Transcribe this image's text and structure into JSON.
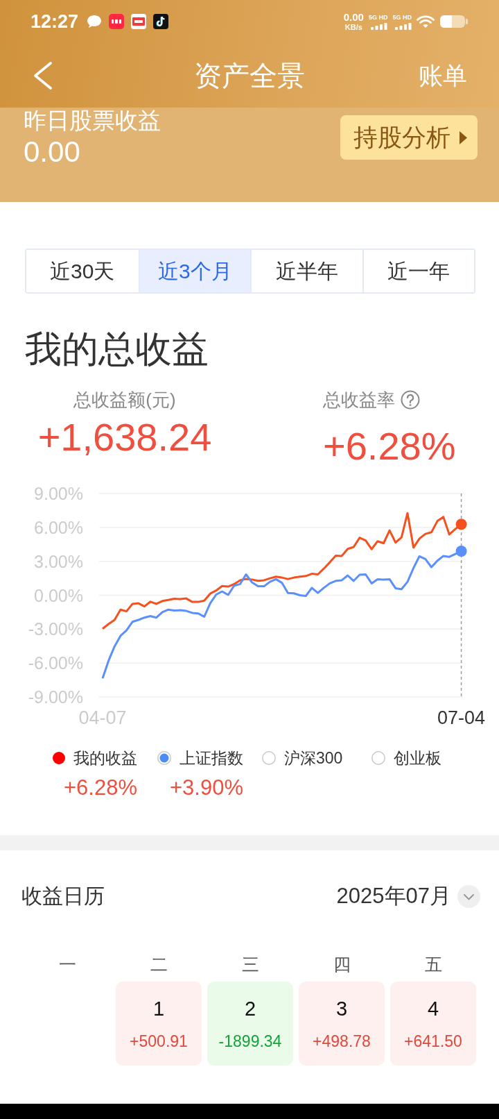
{
  "status_bar": {
    "time": "12:27",
    "net_speed": "0.00",
    "net_unit": "KB/s",
    "signals": [
      {
        "label": "5G HD"
      },
      {
        "label": "5G HD"
      }
    ]
  },
  "header": {
    "title": "资产全景",
    "action": "账单"
  },
  "summary": {
    "label": "昨日股票收益",
    "value": "0.00",
    "button": "持股分析"
  },
  "ranges": [
    {
      "label": "近30天",
      "selected": false
    },
    {
      "label": "近3个月",
      "selected": true
    },
    {
      "label": "近半年",
      "selected": false
    },
    {
      "label": "近一年",
      "selected": false
    }
  ],
  "earnings": {
    "title": "我的总收益",
    "metrics": [
      {
        "label": "总收益额(元)",
        "value": "+1,638.24"
      },
      {
        "label": "总收益率",
        "value": "+6.28%",
        "help": true
      }
    ],
    "chart_data": {
      "type": "line",
      "categories": [
        "04-07",
        null,
        null,
        null,
        null,
        null,
        null,
        null,
        null,
        null,
        null,
        null,
        null,
        null,
        null,
        null,
        null,
        null,
        null,
        null,
        null,
        null,
        null,
        null,
        null,
        null,
        null,
        null,
        null,
        null,
        null,
        null,
        null,
        null,
        null,
        null,
        null,
        null,
        null,
        null,
        null,
        null,
        null,
        null,
        null,
        null,
        null,
        null,
        null,
        null,
        null,
        null,
        null,
        null,
        null,
        null,
        null,
        null,
        null,
        null,
        "07-04"
      ],
      "series": [
        {
          "color": "#f4511e",
          "values": [
            -2.97,
            -2.55,
            -2.18,
            -1.27,
            -1.42,
            -0.76,
            -0.71,
            -0.99,
            -0.57,
            -0.76,
            -0.51,
            -0.42,
            -0.31,
            -0.34,
            -0.28,
            -0.59,
            -0.59,
            -0.48,
            0.14,
            0.42,
            0.82,
            0.76,
            0.99,
            1.33,
            1.44,
            1.39,
            1.27,
            1.33,
            1.5,
            1.64,
            1.56,
            1.44,
            1.56,
            1.64,
            1.7,
            1.9,
            1.84,
            2.35,
            2.91,
            3.51,
            3.48,
            4.1,
            4.27,
            5.09,
            4.84,
            4.07,
            4.78,
            4.61,
            5.74,
            4.67,
            5.12,
            7.27,
            4.22,
            5.01,
            5.43,
            5.57,
            6.57,
            6.93,
            5.38,
            5.86,
            6.28
          ]
        },
        {
          "color": "#5b8ff9",
          "values": [
            -7.36,
            -5.8,
            -4.53,
            -3.59,
            -3.11,
            -2.35,
            -2.18,
            -1.98,
            -1.84,
            -1.98,
            -1.5,
            -1.27,
            -1.36,
            -1.33,
            -1.39,
            -1.56,
            -1.61,
            -1.9,
            -0.71,
            0.06,
            0.34,
            0.03,
            0.85,
            0.99,
            1.84,
            1.13,
            0.79,
            0.79,
            1.19,
            1.42,
            1.1,
            0.2,
            0.17,
            0,
            -0.06,
            0.65,
            0.2,
            0.65,
            1.05,
            1.27,
            1.33,
            1.75,
            1.27,
            1.81,
            1.84,
            1.05,
            1.42,
            1.39,
            1.42,
            0.62,
            0.54,
            1.19,
            2.41,
            3.45,
            3.2,
            2.49,
            3.06,
            3.48,
            3.4,
            3.65,
            3.9
          ]
        }
      ],
      "ylim": [
        -9,
        9
      ],
      "yticks": [
        {
          "value": 9,
          "label": "9.00%"
        },
        {
          "value": 6,
          "label": "6.00%"
        },
        {
          "value": 3,
          "label": "3.00%"
        },
        {
          "value": 0,
          "label": "0.00%"
        },
        {
          "value": -3,
          "label": "-3.00%"
        },
        {
          "value": -6,
          "label": "-6.00%"
        },
        {
          "value": -9,
          "label": "-9.00%"
        }
      ],
      "grid": true
    },
    "legend": [
      {
        "kind": "dot",
        "label": "我的收益",
        "selected": true,
        "color": "#ff0000",
        "value": "+6.28%"
      },
      {
        "kind": "radio",
        "label": "上证指数",
        "selected": true,
        "color": "#4d8bf5",
        "value": "+3.90%"
      },
      {
        "kind": "radio",
        "label": "沪深300",
        "selected": false
      },
      {
        "kind": "radio",
        "label": "创业板",
        "selected": false
      }
    ]
  },
  "calendar": {
    "title": "收益日历",
    "month": "2025年07月",
    "weekdays": [
      "一",
      "二",
      "三",
      "四",
      "五"
    ],
    "days": [
      {
        "kind": "blank"
      },
      {
        "kind": "gain",
        "day": "1",
        "amount": "+500.91"
      },
      {
        "kind": "loss",
        "day": "2",
        "amount": "-1899.34"
      },
      {
        "kind": "gain",
        "day": "3",
        "amount": "+498.78"
      },
      {
        "kind": "gain",
        "day": "4",
        "amount": "+641.50"
      }
    ]
  }
}
